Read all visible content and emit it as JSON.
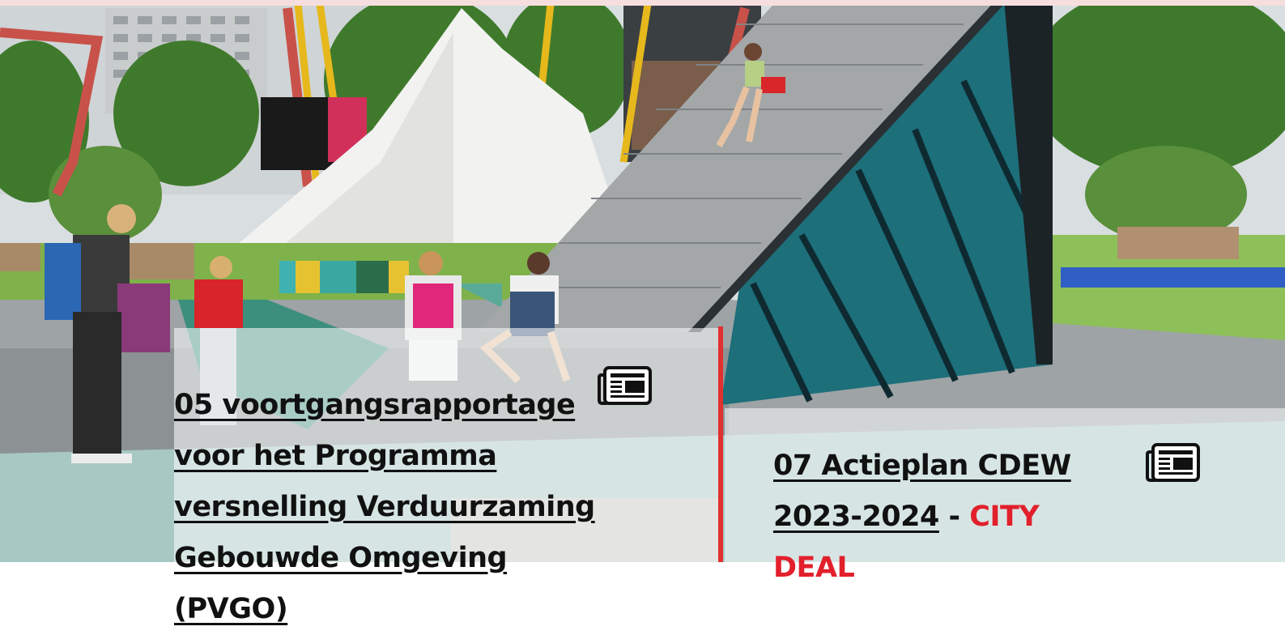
{
  "colors": {
    "accent_red": "#e2202c",
    "divider_red": "#e03030",
    "title_text": "#111111"
  },
  "cards": [
    {
      "title": "05 voortgangsrapportage voor het Programma versnelling Verduurzaming Gebouwde Omgeving (PVGO)",
      "icon": "newspaper-icon"
    },
    {
      "title": "07 Actieplan CDEW 2023-2024",
      "separator": " - ",
      "tag": "CITY DEAL",
      "icon": "newspaper-icon"
    }
  ]
}
